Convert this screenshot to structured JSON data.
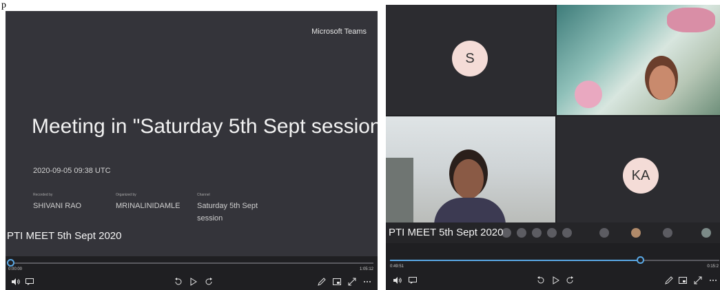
{
  "page_label": "p",
  "left_player": {
    "brand": "Microsoft Teams",
    "meeting_title": "Meeting in \"Saturday 5th Sept session\"",
    "date": "2020-09-05 09:38 UTC",
    "recorded_by_key": "Recorded by",
    "recorded_by": "SHIVANI RAO",
    "organized_by_key": "Organized by",
    "organized_by": "MRINALINIDAMLE",
    "channel_key": "Channel",
    "channel": "Saturday 5th Sept session",
    "recording_name": "PTI MEET 5th Sept 2020",
    "time_current": "0:00:00",
    "time_total": "1:05:12",
    "progress": 0
  },
  "right_player": {
    "tile_s_initial": "S",
    "tile_ka_initials": "KA",
    "recording_name": "PTI MEET 5th Sept 2020",
    "time_current": "0:49:51",
    "time_total": "0:15:2",
    "progress": 0.76
  },
  "icons": {
    "volume": "volume-icon",
    "captions": "captions-icon",
    "rewind": "rewind-10-icon",
    "play": "play-icon",
    "forward": "forward-10-icon",
    "pen": "pen-icon",
    "pip": "picture-in-picture-icon",
    "fullscreen": "fullscreen-icon",
    "more": "more-icon"
  },
  "colors": {
    "accent": "#5aa9e6",
    "player_bg": "#1f1f22",
    "slide_bg": "#34343a"
  }
}
